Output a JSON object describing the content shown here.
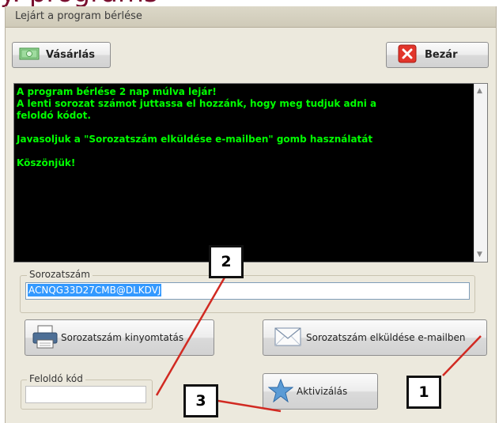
{
  "window": {
    "title": "Lejárt a program bérlése",
    "top_fragment": "y. programs"
  },
  "toolbar": {
    "buy_label": "Vásárlás",
    "close_label": "Bezár"
  },
  "message": {
    "lines": [
      "A program bérlése 2 nap múlva lejár!",
      "A lenti sorozat számot juttassa el hozzánk, hogy meg tudjuk adni a",
      "feloldó kódot.",
      "",
      "Javasoljuk a \"Sorozatszám elküldése e-mailben\" gomb használatát",
      "",
      "Köszönjük!"
    ],
    "text_color": "#00ff00",
    "background": "#000000"
  },
  "serial": {
    "label": "Sorozatszám",
    "value": "ACNQG33D27CMB@DLKDVJ"
  },
  "buttons": {
    "print": "Sorozatszám kinyomtatás",
    "email": "Sorozatszám elküldése e-mailben",
    "activate": "Aktivizálás"
  },
  "unlock_code": {
    "label": "Feloldó kód",
    "value": ""
  },
  "callouts": {
    "one": "1",
    "two": "2",
    "three": "3"
  },
  "icons": {
    "buy": "money-icon",
    "close": "red-x-icon",
    "print": "printer-icon",
    "email": "envelope-icon",
    "activate": "star-icon"
  }
}
